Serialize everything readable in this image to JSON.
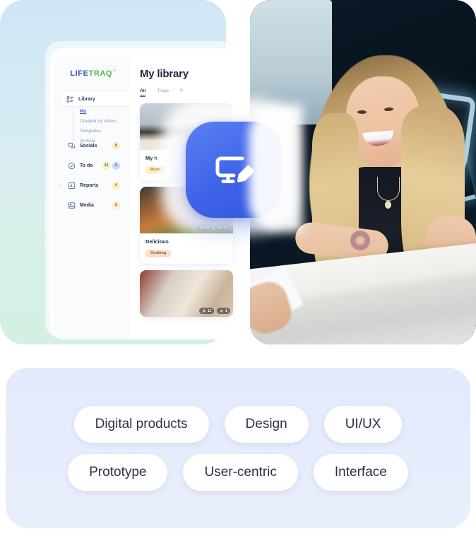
{
  "app": {
    "brand": {
      "part1": "LIFE",
      "part2": "TRAQ",
      "tm": "™"
    },
    "sidebar": {
      "items": [
        {
          "label": "Library",
          "icon": "library-icon",
          "active": true,
          "caret": "›",
          "badges": []
        },
        {
          "label": "Socials",
          "icon": "socials-icon",
          "active": false,
          "caret": "",
          "badges": [
            "8"
          ]
        },
        {
          "label": "To do",
          "icon": "todo-icon",
          "active": false,
          "caret": "",
          "badges": [
            "12",
            "2"
          ]
        },
        {
          "label": "Reports",
          "icon": "reports-icon",
          "active": false,
          "caret": "⌄",
          "badges": [
            "4"
          ]
        },
        {
          "label": "Media",
          "icon": "media-icon",
          "active": false,
          "caret": "",
          "badges": [
            "2"
          ]
        }
      ],
      "sub_items": [
        {
          "label": "My",
          "current": true
        },
        {
          "label": "Created by others",
          "current": false
        },
        {
          "label": "Templates",
          "current": false
        },
        {
          "label": "Archive",
          "current": false
        }
      ]
    },
    "main": {
      "page_title": "My library",
      "tabs": [
        {
          "label": "All",
          "active": true
        },
        {
          "label": "Traqs",
          "active": false
        },
        {
          "label": "P",
          "active": false
        }
      ],
      "cards": [
        {
          "title": "My h",
          "chip": "Runn",
          "chip_color": "amber",
          "views": "",
          "people": ""
        },
        {
          "title": "Delicious",
          "chip": "Cooking",
          "chip_color": "peach",
          "views": "14",
          "people": "15"
        },
        {
          "title": "",
          "chip": "",
          "chip_color": "amber",
          "views": "11",
          "people": "1"
        }
      ]
    },
    "app_icon": {
      "name": "screen-edit-icon",
      "color": "#3e63e8"
    }
  },
  "photo": {
    "name": "woman-smiling-at-desk-photo",
    "alt_elements": [
      "neon-rocket-sign",
      "desk",
      "blonde-woman"
    ]
  },
  "tags": {
    "row1": [
      "Digital products",
      "Design",
      "UI/UX"
    ],
    "row2": [
      "Prototype",
      "User-centric",
      "Interface"
    ]
  },
  "colors": {
    "accent_blue": "#3e63e8",
    "brand_blue": "#3b56b8",
    "brand_green": "#4cb648",
    "tags_panel": "#e6ecfc",
    "badge_amber": "#fdeec2",
    "badge_blue": "#c5dcfb"
  }
}
